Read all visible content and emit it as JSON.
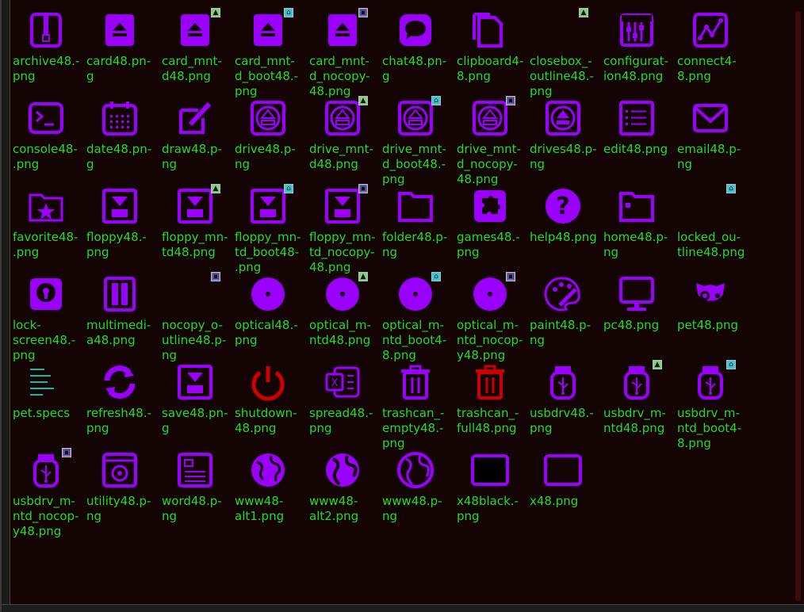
{
  "colors": {
    "icon": "#9900ff",
    "icon_red": "#cc0000",
    "label": "#22dd22",
    "background": "#140404",
    "spec_lines": "#1fb3a8"
  },
  "files": [
    {
      "label": "archive48.-\npng",
      "icon": "archive-icon"
    },
    {
      "label": "card48.pn-\ng",
      "icon": "card-icon"
    },
    {
      "label": "card_mnt-\nd48.png",
      "icon": "card-icon",
      "badge": "g"
    },
    {
      "label": "card_mnt-\nd_boot48.-\npng",
      "icon": "card-icon",
      "badge": "c"
    },
    {
      "label": "card_mnt-\nd_nocopy-\n48.png",
      "icon": "card-icon",
      "badge": "p"
    },
    {
      "label": "chat48.pn-\ng",
      "icon": "chat-icon"
    },
    {
      "label": "clipboard4-\n8.png",
      "icon": "clipboard-icon"
    },
    {
      "label": "closebox_-\noutline48.-\npng",
      "icon": "closebox-outline-icon",
      "badge": "g"
    },
    {
      "label": "configurat-\nion48.png",
      "icon": "configuration-icon"
    },
    {
      "label": "connect4-\n8.png",
      "icon": "connect-icon"
    },
    {
      "label": "console48-\n.png",
      "icon": "console-icon"
    },
    {
      "label": "date48.pn-\ng",
      "icon": "date-icon"
    },
    {
      "label": "draw48.p-\nng",
      "icon": "draw-icon"
    },
    {
      "label": "drive48.p-\nng",
      "icon": "drive-icon"
    },
    {
      "label": "drive_mnt-\nd48.png",
      "icon": "drive-icon",
      "badge": "g"
    },
    {
      "label": "drive_mnt-\nd_boot48.-\npng",
      "icon": "drive-icon",
      "badge": "c"
    },
    {
      "label": "drive_mnt-\nd_nocopy-\n48.png",
      "icon": "drive-icon",
      "badge": "p"
    },
    {
      "label": "drives48.p-\nng",
      "icon": "drives-icon"
    },
    {
      "label": "edit48.png",
      "icon": "edit-icon"
    },
    {
      "label": "email48.p-\nng",
      "icon": "email-icon"
    },
    {
      "label": "favorite48-\n.png",
      "icon": "favorite-icon"
    },
    {
      "label": "floppy48.-\npng",
      "icon": "floppy-icon"
    },
    {
      "label": "floppy_mn-\ntd48.png",
      "icon": "floppy-icon",
      "badge": "g"
    },
    {
      "label": "floppy_mn-\ntd_boot48-\n.png",
      "icon": "floppy-icon",
      "badge": "c"
    },
    {
      "label": "floppy_mn-\ntd_nocopy-\n48.png",
      "icon": "floppy-icon",
      "badge": "p"
    },
    {
      "label": "folder48.p-\nng",
      "icon": "folder-icon"
    },
    {
      "label": "games48.-\npng",
      "icon": "games-icon"
    },
    {
      "label": "help48.png",
      "icon": "help-icon"
    },
    {
      "label": "home48.p-\nng",
      "icon": "home-icon"
    },
    {
      "label": "locked_ou-\ntline48.png",
      "icon": "locked-outline-icon",
      "badge": "c"
    },
    {
      "label": "lock-\nscreen48.-\npng",
      "icon": "lock-screen-icon"
    },
    {
      "label": "multimedi-\na48.png",
      "icon": "multimedia-icon"
    },
    {
      "label": "nocopy_o-\nutline48.p-\nng",
      "icon": "nocopy-outline-icon",
      "badge": "p"
    },
    {
      "label": "optical48.-\npng",
      "icon": "optical-icon"
    },
    {
      "label": "optical_m-\nntd48.png",
      "icon": "optical-icon",
      "badge": "g"
    },
    {
      "label": "optical_m-\nntd_boot4-\n8.png",
      "icon": "optical-icon",
      "badge": "c"
    },
    {
      "label": "optical_m-\nntd_nocop-\ny48.png",
      "icon": "optical-icon",
      "badge": "p"
    },
    {
      "label": "paint48.p-\nng",
      "icon": "paint-icon"
    },
    {
      "label": "pc48.png",
      "icon": "pc-icon"
    },
    {
      "label": "pet48.png",
      "icon": "pet-icon"
    },
    {
      "label": "pet.specs",
      "icon": "specs-icon"
    },
    {
      "label": "refresh48.-\npng",
      "icon": "refresh-icon"
    },
    {
      "label": "save48.pn-\ng",
      "icon": "save-icon"
    },
    {
      "label": "shutdown-\n48.png",
      "icon": "shutdown-icon"
    },
    {
      "label": "spread48.-\npng",
      "icon": "spreadsheet-icon"
    },
    {
      "label": "trashcan_-\nempty48.-\npng",
      "icon": "trashcan-empty-icon"
    },
    {
      "label": "trashcan_-\nfull48.png",
      "icon": "trashcan-full-icon"
    },
    {
      "label": "usbdrv48.-\npng",
      "icon": "usb-drive-icon"
    },
    {
      "label": "usbdrv_m-\nntd48.png",
      "icon": "usb-drive-icon",
      "badge": "g"
    },
    {
      "label": "usbdrv_m-\nntd_boot4-\n8.png",
      "icon": "usb-drive-icon",
      "badge": "c"
    },
    {
      "label": "usbdrv_m-\nntd_nocop-\ny48.png",
      "icon": "usb-drive-icon",
      "badge": "p"
    },
    {
      "label": "utility48.p-\nng",
      "icon": "utility-icon"
    },
    {
      "label": "word48.p-\nng",
      "icon": "word-icon"
    },
    {
      "label": "www48-\nalt1.png",
      "icon": "globe-alt1-icon"
    },
    {
      "label": "www48-\nalt2.png",
      "icon": "globe-alt2-icon"
    },
    {
      "label": "www48.p-\nng",
      "icon": "globe-icon"
    },
    {
      "label": "x48black.-\npng",
      "icon": "black-box-icon"
    },
    {
      "label": "x48.png",
      "icon": "empty-box-icon"
    }
  ]
}
